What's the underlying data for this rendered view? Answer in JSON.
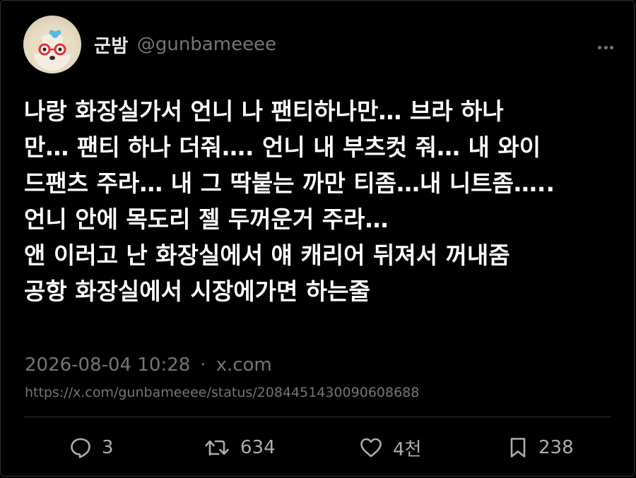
{
  "author": {
    "name": "군밤",
    "handle": "@gunbameeee",
    "avatar": "puppy-with-red-glasses-and-blue-hairclip"
  },
  "tweet": {
    "lines": [
      "나랑 화장실가서 언니 나 팬티하나만… 브라 하나",
      "만… 팬티 하나 더줘…. 언니 내 부츠컷 줘… 내 와이",
      "드팬츠 주라… 내 그 딱붙는 까만 티좀…내 니트좀…..",
      "언니 안에 목도리 젤 두꺼운거 주라…",
      "앤 이러고 난 화장실에서 얘 캐리어 뒤져서 꺼내줌",
      "공항 화장실에서 시장에가면 하는줄"
    ]
  },
  "meta": {
    "timestamp": "2026-08-04 10:28",
    "separator": "·",
    "source": "x.com",
    "url": "https://x.com/gunbameeee/status/2084451430090608688"
  },
  "actions": {
    "replies": "3",
    "retweets": "634",
    "likes": "4천",
    "bookmarks": "238"
  },
  "colors": {
    "background": "#000000",
    "text": "#ffffff",
    "secondary": "#71767b",
    "divider": "#2f3336"
  }
}
